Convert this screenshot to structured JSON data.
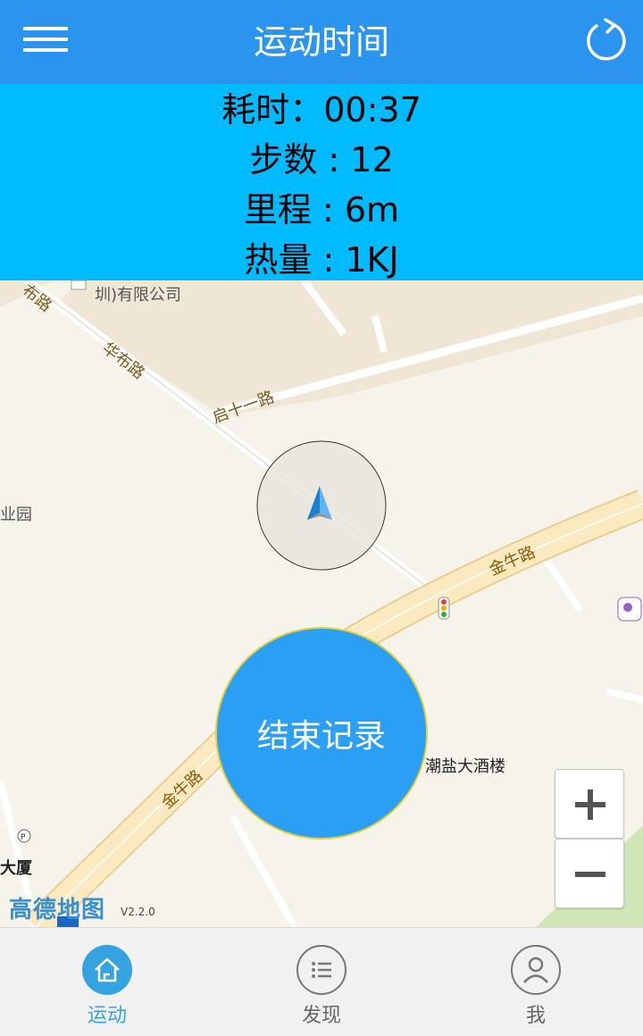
{
  "header": {
    "title": "运动时间",
    "menu_icon": "hamburger-menu-icon",
    "refresh_icon": "refresh-icon",
    "background_color": "#2b94ee"
  },
  "stats": {
    "background_color": "#00bbff",
    "duration": "耗时：00:37",
    "steps": "步数 : 12",
    "distance": "里程 : 6m",
    "calories": "热量 : 1KJ"
  },
  "map": {
    "roads": [
      "华布路",
      "启十一路",
      "金牛路",
      "金牛路",
      "布路"
    ],
    "pois": [
      "圳)有限公司",
      "业园",
      "潮盐大酒楼",
      "大厦"
    ],
    "provider_logo": "高德地图",
    "version": "V2.2.0",
    "location_marker_icon": "navigation-arrow-icon",
    "zoom_in_icon": "plus-icon",
    "zoom_out_icon": "minus-icon"
  },
  "actions": {
    "end_record": "结束记录",
    "end_record_color": "#2b9ff3"
  },
  "tabbar": {
    "tabs": [
      {
        "label": "运动",
        "icon": "home-icon",
        "active": true
      },
      {
        "label": "发现",
        "icon": "list-icon",
        "active": false
      },
      {
        "label": "我",
        "icon": "user-icon",
        "active": false
      }
    ],
    "active_color": "#35a3e0",
    "inactive_color": "#666666"
  }
}
